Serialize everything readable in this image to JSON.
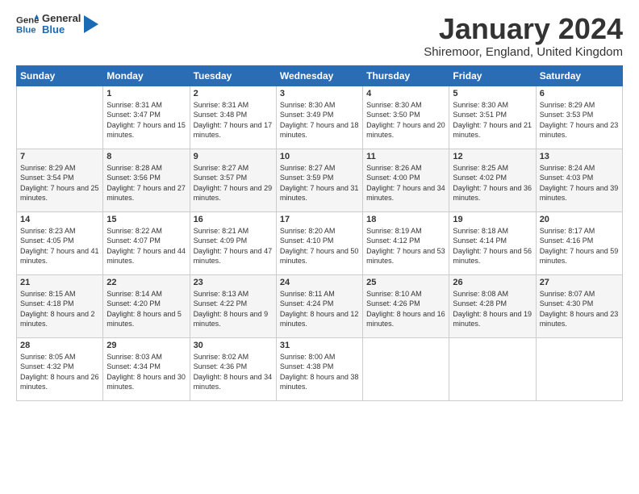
{
  "header": {
    "logo_general": "General",
    "logo_blue": "Blue",
    "month": "January 2024",
    "location": "Shiremoor, England, United Kingdom"
  },
  "weekdays": [
    "Sunday",
    "Monday",
    "Tuesday",
    "Wednesday",
    "Thursday",
    "Friday",
    "Saturday"
  ],
  "weeks": [
    [
      {
        "day": "",
        "sunrise": "",
        "sunset": "",
        "daylight": ""
      },
      {
        "day": "1",
        "sunrise": "Sunrise: 8:31 AM",
        "sunset": "Sunset: 3:47 PM",
        "daylight": "Daylight: 7 hours and 15 minutes."
      },
      {
        "day": "2",
        "sunrise": "Sunrise: 8:31 AM",
        "sunset": "Sunset: 3:48 PM",
        "daylight": "Daylight: 7 hours and 17 minutes."
      },
      {
        "day": "3",
        "sunrise": "Sunrise: 8:30 AM",
        "sunset": "Sunset: 3:49 PM",
        "daylight": "Daylight: 7 hours and 18 minutes."
      },
      {
        "day": "4",
        "sunrise": "Sunrise: 8:30 AM",
        "sunset": "Sunset: 3:50 PM",
        "daylight": "Daylight: 7 hours and 20 minutes."
      },
      {
        "day": "5",
        "sunrise": "Sunrise: 8:30 AM",
        "sunset": "Sunset: 3:51 PM",
        "daylight": "Daylight: 7 hours and 21 minutes."
      },
      {
        "day": "6",
        "sunrise": "Sunrise: 8:29 AM",
        "sunset": "Sunset: 3:53 PM",
        "daylight": "Daylight: 7 hours and 23 minutes."
      }
    ],
    [
      {
        "day": "7",
        "sunrise": "Sunrise: 8:29 AM",
        "sunset": "Sunset: 3:54 PM",
        "daylight": "Daylight: 7 hours and 25 minutes."
      },
      {
        "day": "8",
        "sunrise": "Sunrise: 8:28 AM",
        "sunset": "Sunset: 3:56 PM",
        "daylight": "Daylight: 7 hours and 27 minutes."
      },
      {
        "day": "9",
        "sunrise": "Sunrise: 8:27 AM",
        "sunset": "Sunset: 3:57 PM",
        "daylight": "Daylight: 7 hours and 29 minutes."
      },
      {
        "day": "10",
        "sunrise": "Sunrise: 8:27 AM",
        "sunset": "Sunset: 3:59 PM",
        "daylight": "Daylight: 7 hours and 31 minutes."
      },
      {
        "day": "11",
        "sunrise": "Sunrise: 8:26 AM",
        "sunset": "Sunset: 4:00 PM",
        "daylight": "Daylight: 7 hours and 34 minutes."
      },
      {
        "day": "12",
        "sunrise": "Sunrise: 8:25 AM",
        "sunset": "Sunset: 4:02 PM",
        "daylight": "Daylight: 7 hours and 36 minutes."
      },
      {
        "day": "13",
        "sunrise": "Sunrise: 8:24 AM",
        "sunset": "Sunset: 4:03 PM",
        "daylight": "Daylight: 7 hours and 39 minutes."
      }
    ],
    [
      {
        "day": "14",
        "sunrise": "Sunrise: 8:23 AM",
        "sunset": "Sunset: 4:05 PM",
        "daylight": "Daylight: 7 hours and 41 minutes."
      },
      {
        "day": "15",
        "sunrise": "Sunrise: 8:22 AM",
        "sunset": "Sunset: 4:07 PM",
        "daylight": "Daylight: 7 hours and 44 minutes."
      },
      {
        "day": "16",
        "sunrise": "Sunrise: 8:21 AM",
        "sunset": "Sunset: 4:09 PM",
        "daylight": "Daylight: 7 hours and 47 minutes."
      },
      {
        "day": "17",
        "sunrise": "Sunrise: 8:20 AM",
        "sunset": "Sunset: 4:10 PM",
        "daylight": "Daylight: 7 hours and 50 minutes."
      },
      {
        "day": "18",
        "sunrise": "Sunrise: 8:19 AM",
        "sunset": "Sunset: 4:12 PM",
        "daylight": "Daylight: 7 hours and 53 minutes."
      },
      {
        "day": "19",
        "sunrise": "Sunrise: 8:18 AM",
        "sunset": "Sunset: 4:14 PM",
        "daylight": "Daylight: 7 hours and 56 minutes."
      },
      {
        "day": "20",
        "sunrise": "Sunrise: 8:17 AM",
        "sunset": "Sunset: 4:16 PM",
        "daylight": "Daylight: 7 hours and 59 minutes."
      }
    ],
    [
      {
        "day": "21",
        "sunrise": "Sunrise: 8:15 AM",
        "sunset": "Sunset: 4:18 PM",
        "daylight": "Daylight: 8 hours and 2 minutes."
      },
      {
        "day": "22",
        "sunrise": "Sunrise: 8:14 AM",
        "sunset": "Sunset: 4:20 PM",
        "daylight": "Daylight: 8 hours and 5 minutes."
      },
      {
        "day": "23",
        "sunrise": "Sunrise: 8:13 AM",
        "sunset": "Sunset: 4:22 PM",
        "daylight": "Daylight: 8 hours and 9 minutes."
      },
      {
        "day": "24",
        "sunrise": "Sunrise: 8:11 AM",
        "sunset": "Sunset: 4:24 PM",
        "daylight": "Daylight: 8 hours and 12 minutes."
      },
      {
        "day": "25",
        "sunrise": "Sunrise: 8:10 AM",
        "sunset": "Sunset: 4:26 PM",
        "daylight": "Daylight: 8 hours and 16 minutes."
      },
      {
        "day": "26",
        "sunrise": "Sunrise: 8:08 AM",
        "sunset": "Sunset: 4:28 PM",
        "daylight": "Daylight: 8 hours and 19 minutes."
      },
      {
        "day": "27",
        "sunrise": "Sunrise: 8:07 AM",
        "sunset": "Sunset: 4:30 PM",
        "daylight": "Daylight: 8 hours and 23 minutes."
      }
    ],
    [
      {
        "day": "28",
        "sunrise": "Sunrise: 8:05 AM",
        "sunset": "Sunset: 4:32 PM",
        "daylight": "Daylight: 8 hours and 26 minutes."
      },
      {
        "day": "29",
        "sunrise": "Sunrise: 8:03 AM",
        "sunset": "Sunset: 4:34 PM",
        "daylight": "Daylight: 8 hours and 30 minutes."
      },
      {
        "day": "30",
        "sunrise": "Sunrise: 8:02 AM",
        "sunset": "Sunset: 4:36 PM",
        "daylight": "Daylight: 8 hours and 34 minutes."
      },
      {
        "day": "31",
        "sunrise": "Sunrise: 8:00 AM",
        "sunset": "Sunset: 4:38 PM",
        "daylight": "Daylight: 8 hours and 38 minutes."
      },
      {
        "day": "",
        "sunrise": "",
        "sunset": "",
        "daylight": ""
      },
      {
        "day": "",
        "sunrise": "",
        "sunset": "",
        "daylight": ""
      },
      {
        "day": "",
        "sunrise": "",
        "sunset": "",
        "daylight": ""
      }
    ]
  ]
}
